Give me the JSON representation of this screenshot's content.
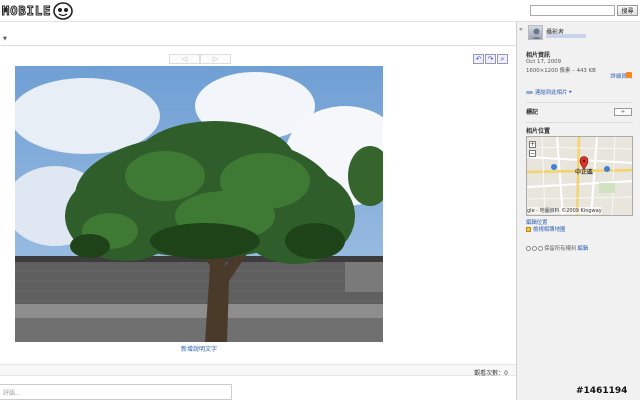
{
  "header": {
    "logo_text": "MOBILE",
    "search_placeholder": "",
    "search_button": "搜尋"
  },
  "viewer": {
    "prev_icon": "◁",
    "next_icon": "▷",
    "caption_link": "新增說明文字",
    "views_label": "觀看次數：0",
    "comment_placeholder": "評語..."
  },
  "side": {
    "collapse": "«",
    "user_name": "攝影者",
    "photo_info_title": "相片資訊",
    "date": "Oct 17, 2009",
    "dims": "1600×1200 像素 – 443 KB",
    "details_link": "詳細資訊",
    "link_to_photo": "連結到此相片",
    "tags_title": "標記",
    "tags_add": "+",
    "location_title": "相片位置",
    "map_district": "中正區",
    "map_attribution": "gle - 地圖資料 ©2009 Kingway",
    "edit_location": "編輯位置",
    "view_map": "檢視相簿地圖",
    "license_text": "保留所有權利",
    "license_edit": "編輯"
  },
  "watermark": "#1461194"
}
